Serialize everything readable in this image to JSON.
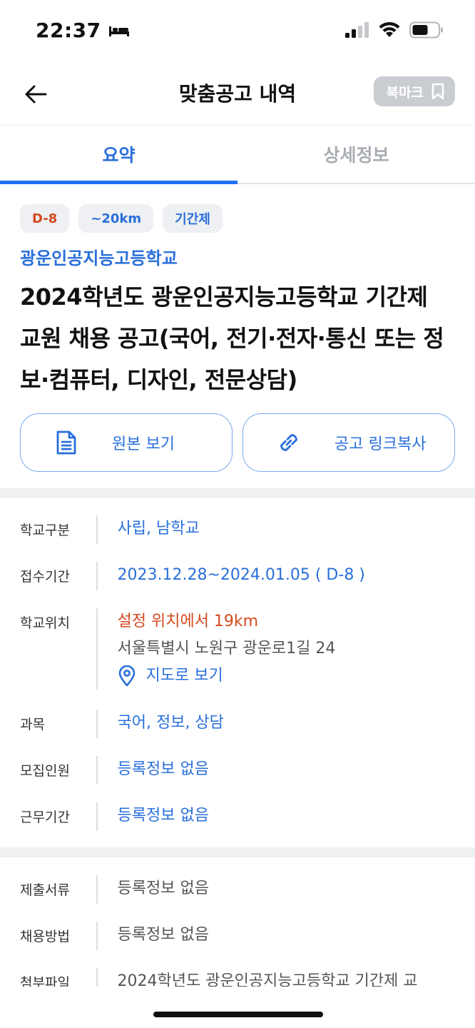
{
  "status_bar": {
    "time": "22:37"
  },
  "header": {
    "title": "맞춤공고 내역",
    "bookmark_label": "북마크"
  },
  "tabs": [
    {
      "label": "요약",
      "active": true
    },
    {
      "label": "상세정보",
      "active": false
    }
  ],
  "summary": {
    "chips": [
      "D-8",
      "~20km",
      "기간제"
    ],
    "school_name": "광운인공지능고등학교",
    "title": "2024학년도 광운인공지능고등학교 기간제 교원 채용 공고(국어, 전기·전자·통신 또는 정보·컴퓨터, 디자인, 전문상담)",
    "view_original": "원본 보기",
    "copy_link": "공고 링크복사"
  },
  "info": {
    "school_type": {
      "label": "학교구분",
      "value": "사립, 남학교"
    },
    "period": {
      "label": "접수기간",
      "value": "2023.12.28~2024.01.05",
      "dday": "( D-8 )"
    },
    "location": {
      "label": "학교위치",
      "distance": "설정 위치에서 19km",
      "address": "서울특별시 노원구 광운로1길 24",
      "map_link": "지도로 보기"
    },
    "subject": {
      "label": "과목",
      "value": "국어, 정보, 상담"
    },
    "headcount": {
      "label": "모집인원",
      "value": "등록정보 없음"
    },
    "work_period": {
      "label": "근무기간",
      "value": "등록정보 없음"
    }
  },
  "info2": {
    "documents": {
      "label": "제출서류",
      "value": "등록정보 없음"
    },
    "method": {
      "label": "채용방법",
      "value": "등록정보 없음"
    },
    "attachment": {
      "label": "첨부파일",
      "value": "2024학년도 광운인공지능고등학교 기간제 교"
    }
  },
  "colors": {
    "accent": "#2a6fdb",
    "dday": "#d44a1e",
    "bookmark_bg": "#c9ccd1"
  }
}
